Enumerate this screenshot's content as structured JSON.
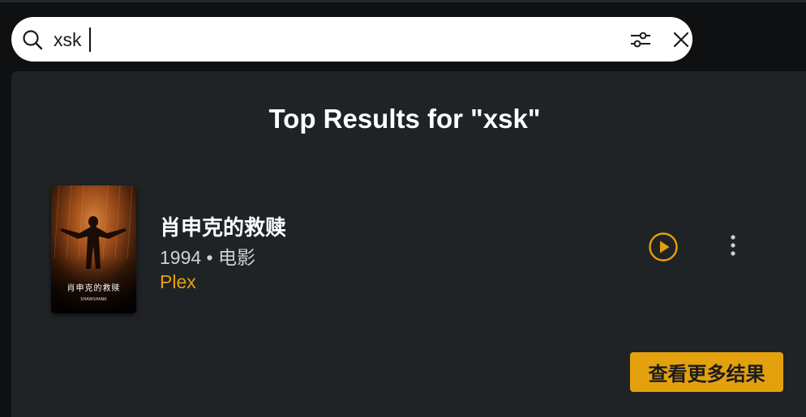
{
  "search": {
    "value": "xsk",
    "icons": {
      "search": "search-icon",
      "filter": "sliders-icon",
      "clear": "close-icon"
    }
  },
  "results": {
    "heading": "Top Results for \"xsk\"",
    "items": [
      {
        "title": "肖申克的救赎",
        "meta": "1994 • 电影",
        "source": "Plex",
        "poster": {
          "title_text": "肖申克的救赎",
          "subtitle_text": "SHAWSHANK"
        }
      }
    ],
    "more_label": "查看更多结果"
  },
  "colors": {
    "accent": "#e5a00d",
    "panel": "#1f2326",
    "background": "#0f1012",
    "text": "#ffffff",
    "muted": "#cfd1d3"
  }
}
